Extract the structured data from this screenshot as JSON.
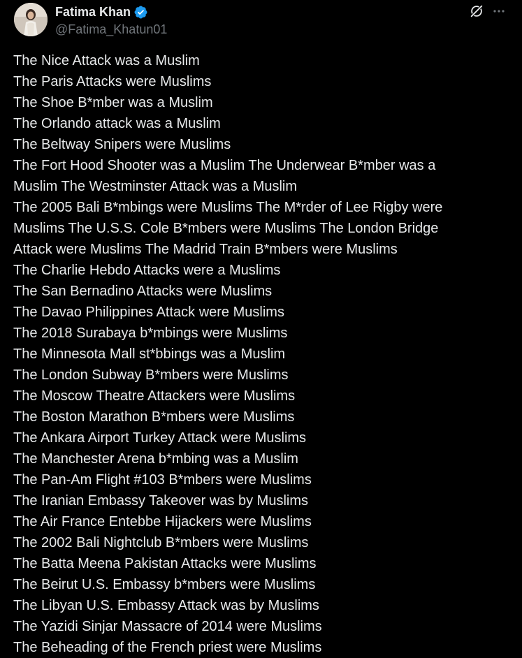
{
  "author": {
    "display_name": "Fatima Khan",
    "handle": "@Fatima_Khatun01",
    "verified_icon": "verified-badge-icon",
    "verified_color": "#1d9bf0"
  },
  "actions": {
    "grok_icon": "grok-icon",
    "more_icon": "more-options-icon"
  },
  "colors": {
    "background": "#000000",
    "text_primary": "#e7e9ea",
    "text_secondary": "#71767b"
  },
  "tweet": {
    "lines": [
      "The Nice Attack was a Muslim",
      "The Paris Attacks were Muslims",
      "The Shoe B*mber was a Muslim",
      "The Orlando attack was a Muslim",
      "The Beltway Snipers were Muslims",
      "The Fort Hood Shooter was a Muslim The Underwear B*mber was a",
      "Muslim The Westminster Attack was a Muslim",
      "The 2005 Bali B*mbings were Muslims The M*rder of Lee Rigby were",
      "Muslims The U.S.S. Cole B*mbers were Muslims The London Bridge",
      "Attack were Muslims The Madrid Train B*mbers were Muslims",
      "The Charlie Hebdo Attacks were a Muslims",
      "The San Bernadino Attacks were Muslims",
      "The Davao Philippines Attack were Muslims",
      "The 2018 Surabaya b*mbings were Muslims",
      "The Minnesota Mall st*bbings was a Muslim",
      "The London Subway B*mbers were Muslims",
      "The Moscow Theatre Attackers were Muslims",
      "The Boston Marathon B*mbers were Muslims",
      "The Ankara Airport Turkey Attack were Muslims",
      "The Manchester Arena b*mbing was a Muslim",
      "The Pan-Am Flight #103 B*mbers were Muslims",
      "The Iranian Embassy Takeover was by Muslims",
      "The Air France Entebbe Hijackers were Muslims",
      "The 2002 Bali Nightclub B*mbers were Muslims",
      "The Batta Meena Pakistan Attacks were Muslims",
      "The Beirut U.S. Embassy b*mbers were Muslims",
      "The Libyan U.S. Embassy Attack was by Muslims",
      "The Yazidi Sinjar Massacre of 2014 were Muslims",
      "The Beheading of the French priest were Muslims"
    ]
  }
}
